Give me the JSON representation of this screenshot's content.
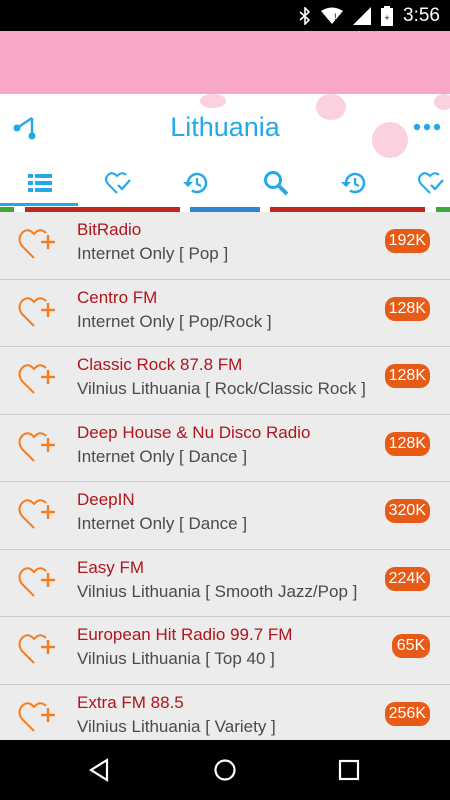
{
  "status_bar": {
    "time": "3:56"
  },
  "header": {
    "title": "Lithuania"
  },
  "tabs": [
    {
      "icon": "list-icon",
      "active": true
    },
    {
      "icon": "favorite-check-icon",
      "active": false
    },
    {
      "icon": "history-icon",
      "active": false
    },
    {
      "icon": "search-icon",
      "active": false
    },
    {
      "icon": "history-icon",
      "active": false
    },
    {
      "icon": "favorite-check-icon",
      "active": false
    }
  ],
  "colors": {
    "accent": "#24a9e8",
    "badge": "#e85b17",
    "station_name": "#b0141c",
    "banner": "#f9a7c6",
    "heart": "#f57c1f"
  },
  "stations": [
    {
      "name": "BitRadio",
      "desc": "Internet Only [ Pop ]",
      "bitrate": "192K"
    },
    {
      "name": "Centro FM",
      "desc": "Internet Only [ Pop/Rock ]",
      "bitrate": "128K"
    },
    {
      "name": "Classic Rock 87.8 FM",
      "desc": "Vilnius Lithuania [ Rock/Classic Rock ]",
      "bitrate": "128K"
    },
    {
      "name": "Deep House & Nu Disco Radio",
      "desc": "Internet Only [ Dance ]",
      "bitrate": "128K"
    },
    {
      "name": "DeepIN",
      "desc": "Internet Only [ Dance ]",
      "bitrate": "320K"
    },
    {
      "name": "Easy FM",
      "desc": "Vilnius Lithuania [ Smooth Jazz/Pop ]",
      "bitrate": "224K"
    },
    {
      "name": "European Hit Radio 99.7 FM",
      "desc": "Vilnius Lithuania [ Top 40 ]",
      "bitrate": "65K"
    },
    {
      "name": "Extra FM 88.5",
      "desc": "Vilnius Lithuania [ Variety ]",
      "bitrate": "256K"
    }
  ]
}
